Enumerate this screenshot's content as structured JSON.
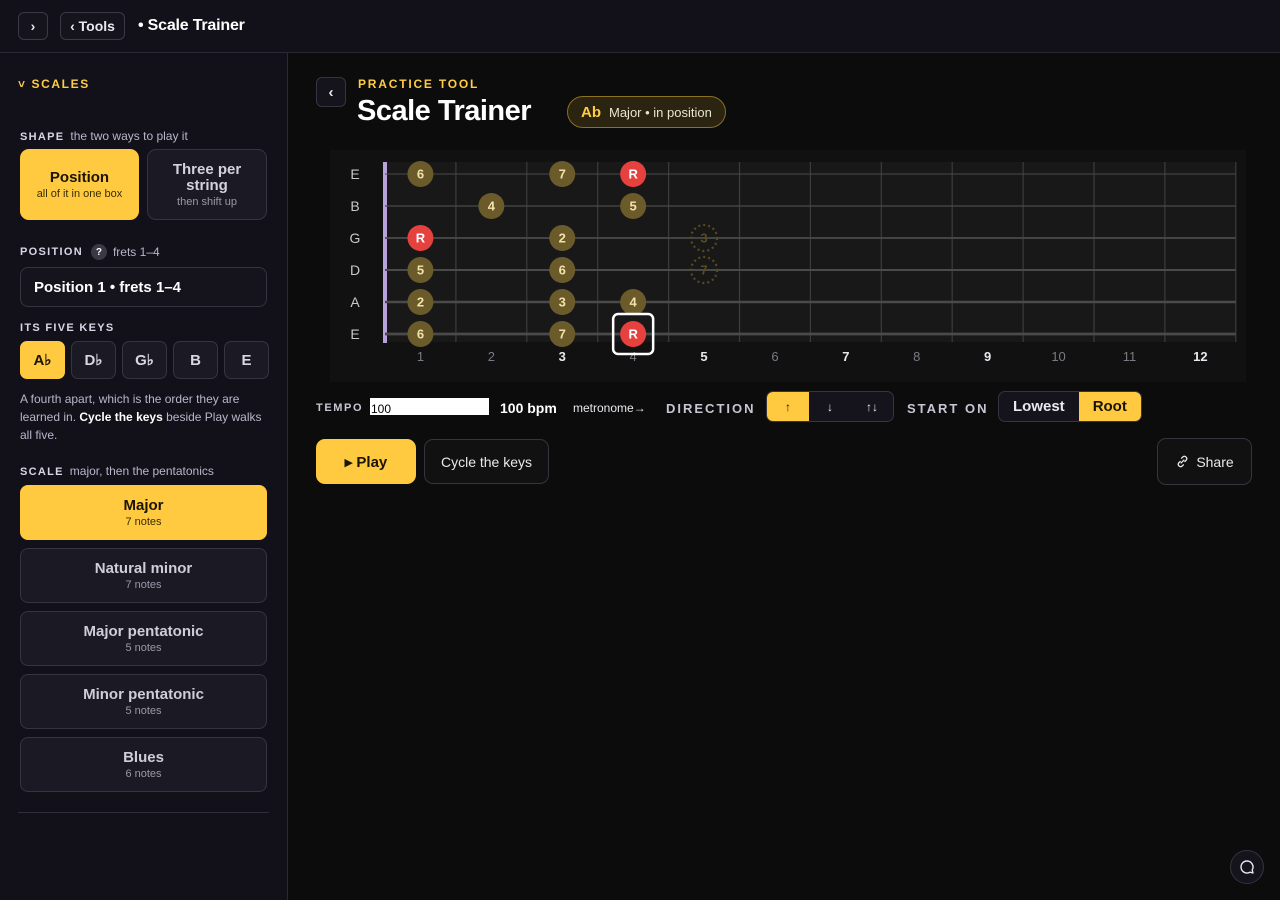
{
  "topbar": {
    "expand_icon": "›",
    "tools_label": "‹ Tools",
    "crumb": "• Scale Trainer"
  },
  "sidebar": {
    "section_title": "˅ SCALES",
    "shape_label": "SHAPE",
    "shape_hint": "the two ways to play it",
    "shapes": [
      {
        "title": "Position",
        "sub": "all of it in one box",
        "active": true
      },
      {
        "title": "Three per string",
        "sub": "then shift up",
        "active": false
      }
    ],
    "position_label": "POSITION",
    "position_help": "?",
    "position_hint": "frets 1–4",
    "position_value": "Position 1 • frets 1–4",
    "keys_label": "ITS FIVE KEYS",
    "keys": [
      "A♭",
      "D♭",
      "G♭",
      "B",
      "E"
    ],
    "active_key_index": 0,
    "keys_note_pre": "A fourth apart, which is the order they are learned in. ",
    "keys_note_bold": "Cycle the keys",
    "keys_note_post": " beside Play walks all five.",
    "scale_label": "SCALE",
    "scale_hint": "major, then the pentatonics",
    "scales": [
      {
        "title": "Major",
        "sub": "7 notes",
        "active": true
      },
      {
        "title": "Natural minor",
        "sub": "7 notes",
        "active": false
      },
      {
        "title": "Major pentatonic",
        "sub": "5 notes",
        "active": false
      },
      {
        "title": "Minor pentatonic",
        "sub": "5 notes",
        "active": false
      },
      {
        "title": "Blues",
        "sub": "6 notes",
        "active": false
      }
    ]
  },
  "main": {
    "back_icon": "‹",
    "eyebrow": "PRACTICE TOOL",
    "title": "Scale Trainer",
    "pill_key": "Ab",
    "pill_desc": "Major • in position"
  },
  "fretboard": {
    "strings": [
      "E",
      "B",
      "G",
      "D",
      "A",
      "E"
    ],
    "fret_numbers": [
      "1",
      "2",
      "3",
      "4",
      "5",
      "6",
      "7",
      "8",
      "9",
      "10",
      "11",
      "12"
    ],
    "bold_frets": [
      3,
      5,
      7,
      9,
      12
    ],
    "colors": {
      "root": "#e5413f",
      "note": "#6b5a2a",
      "note_text": "#f3e2a8",
      "ghost": "#5a4a22"
    },
    "notes": [
      {
        "string": 0,
        "fret": 1,
        "label": "6",
        "kind": "note"
      },
      {
        "string": 0,
        "fret": 3,
        "label": "7",
        "kind": "note"
      },
      {
        "string": 0,
        "fret": 4,
        "label": "R",
        "kind": "root"
      },
      {
        "string": 1,
        "fret": 2,
        "label": "4",
        "kind": "note"
      },
      {
        "string": 1,
        "fret": 4,
        "label": "5",
        "kind": "note"
      },
      {
        "string": 2,
        "fret": 1,
        "label": "R",
        "kind": "root"
      },
      {
        "string": 2,
        "fret": 3,
        "label": "2",
        "kind": "note"
      },
      {
        "string": 2,
        "fret": 5,
        "label": "3",
        "kind": "ghost"
      },
      {
        "string": 3,
        "fret": 1,
        "label": "5",
        "kind": "note"
      },
      {
        "string": 3,
        "fret": 3,
        "label": "6",
        "kind": "note"
      },
      {
        "string": 3,
        "fret": 5,
        "label": "7",
        "kind": "ghost"
      },
      {
        "string": 4,
        "fret": 1,
        "label": "2",
        "kind": "note"
      },
      {
        "string": 4,
        "fret": 3,
        "label": "3",
        "kind": "note"
      },
      {
        "string": 4,
        "fret": 4,
        "label": "4",
        "kind": "note"
      },
      {
        "string": 5,
        "fret": 1,
        "label": "6",
        "kind": "note"
      },
      {
        "string": 5,
        "fret": 3,
        "label": "7",
        "kind": "note"
      },
      {
        "string": 5,
        "fret": 4,
        "label": "R",
        "kind": "root",
        "selected": true
      }
    ]
  },
  "controls": {
    "tempo_label": "TEMPO",
    "tempo_value": "100",
    "bpm_text": "100 bpm",
    "metronome": "metronome→",
    "direction_label": "DIRECTION",
    "direction_options": [
      "↑",
      "↓",
      "↑↓"
    ],
    "direction_active": 0,
    "start_label": "START ON",
    "start_options": [
      "Lowest",
      "Root"
    ],
    "start_active": 1,
    "play_label": "▸ Play",
    "cycle_label": "Cycle the keys",
    "share_label": "Share"
  }
}
